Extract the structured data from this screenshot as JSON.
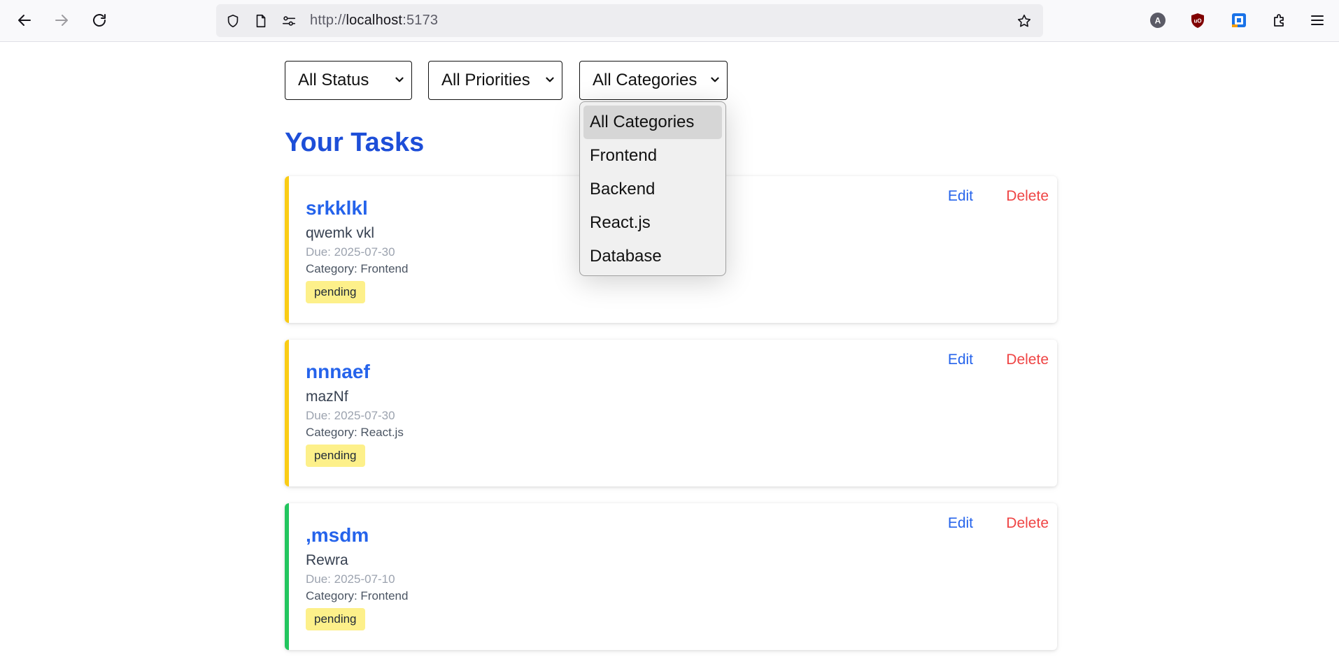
{
  "browser": {
    "url_scheme": "http://",
    "url_host": "localhost",
    "url_port": ":5173",
    "profile_initial": "A"
  },
  "filters": {
    "status": "All Status",
    "priority": "All Priorities",
    "category": "All Categories"
  },
  "category_dropdown": {
    "options": [
      "All Categories",
      "Frontend",
      "Backend",
      "React.js",
      "Database"
    ],
    "selected": "All Categories"
  },
  "heading": "Your Tasks",
  "actions": {
    "edit": "Edit",
    "delete": "Delete"
  },
  "tasks": [
    {
      "title": "srkklkl",
      "description": "qwemk vkl",
      "due": "Due: 2025-07-30",
      "category": "Category: Frontend",
      "status": "pending",
      "accent": "#facc15"
    },
    {
      "title": "nnnaef",
      "description": "mazNf",
      "due": "Due: 2025-07-30",
      "category": "Category: React.js",
      "status": "pending",
      "accent": "#facc15"
    },
    {
      "title": ",msdm",
      "description": "Rewra",
      "due": "Due: 2025-07-10",
      "category": "Category: Frontend",
      "status": "pending",
      "accent": "#22c55e"
    }
  ],
  "colors": {
    "heading": "#1d4ed8",
    "link": "#2563eb",
    "danger": "#ef4444",
    "badge": "#fdf08a"
  }
}
